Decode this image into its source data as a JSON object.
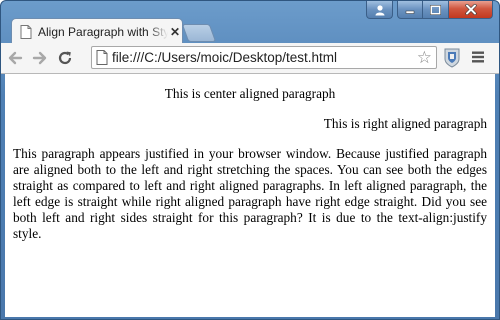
{
  "tab": {
    "title": "Align Paragraph with Style",
    "close_glyph": "✕"
  },
  "toolbar": {
    "back_icon": "arrow-left-icon",
    "forward_icon": "arrow-right-icon",
    "reload_icon": "reload-icon",
    "url": "file:///C:/Users/moic/Desktop/test.html",
    "bookmark_glyph": "☆"
  },
  "content": {
    "center_paragraph": "This is center aligned paragraph",
    "right_paragraph": "This is right aligned paragraph",
    "justify_paragraph": "This paragraph appears justified in your browser window. Because justified paragraph are aligned both to the left and right stretching the spaces. You can see both the edges straight as compared to left and right aligned paragraphs. In left aligned paragraph, the left edge is straight while right aligned paragraph have right edge straight. Did you see both left and right sides straight for this paragraph? It is due to the text-align:justify style."
  },
  "colors": {
    "window_frame": "#4f80b4",
    "close_button": "#c2381f",
    "toolbar": "#f5f5f5"
  }
}
